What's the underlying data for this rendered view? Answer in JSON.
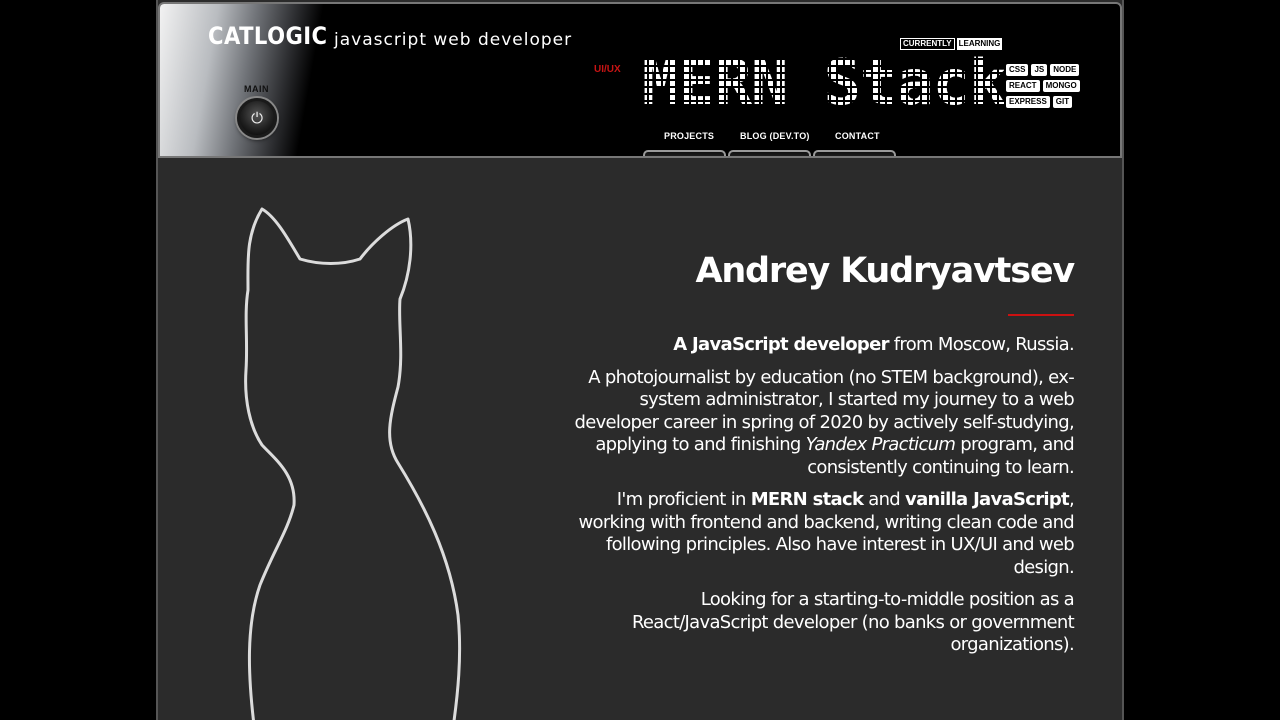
{
  "header": {
    "brand": "CATLOGIC",
    "tagline": "javascript web developer",
    "main_label": "MAIN",
    "uiux_label": "UI/UX",
    "currently": "CURRENTLY",
    "learning": "LEARNING",
    "stack_title": "MERN Stack",
    "tech_tags": [
      "CSS",
      "JS",
      "NODE",
      "REACT",
      "MONGO",
      "EXPRESS",
      "GIT"
    ],
    "nav": {
      "projects": "PROJECTS",
      "blog": "BLOG (DEV.TO)",
      "contact": "CONTACT"
    }
  },
  "about": {
    "name": "Andrey Kudryavtsev",
    "p1_bold": "A JavaScript developer",
    "p1_rest": " from Moscow, Russia.",
    "p2_a": "A photojournalist by education (no STEM background), ex-system administrator, I started my journey to a web developer career in spring of 2020 by actively self-studying, applying to and finishing ",
    "p2_italic": "Yandex Practicum",
    "p2_b": " program, and consistently continuing to learn.",
    "p3_a": "I'm proficient in ",
    "p3_bold1": "MERN stack",
    "p3_b": " and ",
    "p3_bold2": "vanilla JavaScript",
    "p3_c": ", working with frontend and backend, writing clean code and following principles. Also have interest in UX/UI and web design.",
    "p4": "Looking for a starting-to-middle position as a React/JavaScript developer (no banks or government organizations)."
  },
  "colors": {
    "accent_red": "#c81414",
    "panel_bg": "#2b2b2b",
    "header_bg": "#000000"
  }
}
